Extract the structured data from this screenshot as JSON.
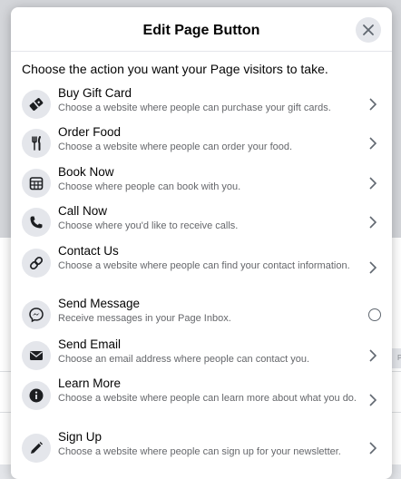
{
  "dialog": {
    "title": "Edit Page Button",
    "prompt": "Choose the action you want your Page visitors to take."
  },
  "background": {
    "pill_text": "Pr"
  },
  "options": [
    {
      "title": "Buy Gift Card",
      "description": "Choose a website where people can purchase your gift cards.",
      "icon": "gift-card-icon",
      "control": "chevron"
    },
    {
      "title": "Order Food",
      "description": "Choose a website where people can order your food.",
      "icon": "fork-knife-icon",
      "control": "chevron"
    },
    {
      "title": "Book Now",
      "description": "Choose where people can book with you.",
      "icon": "calendar-icon",
      "control": "chevron"
    },
    {
      "title": "Call Now",
      "description": "Choose where you'd like to receive calls.",
      "icon": "phone-icon",
      "control": "chevron"
    },
    {
      "title": "Contact Us",
      "description": "Choose a website where people can find your contact information.",
      "icon": "link-icon",
      "control": "chevron"
    },
    {
      "title": "Send Message",
      "description": "Receive messages in your Page Inbox.",
      "icon": "messenger-icon",
      "control": "radio"
    },
    {
      "title": "Send Email",
      "description": "Choose an email address where people can contact you.",
      "icon": "envelope-icon",
      "control": "chevron"
    },
    {
      "title": "Learn More",
      "description": "Choose a website where people can learn more about what you do.",
      "icon": "info-icon",
      "control": "chevron"
    },
    {
      "title": "Sign Up",
      "description": "Choose a website where people can sign up for your newsletter.",
      "icon": "pencil-icon",
      "control": "chevron"
    }
  ]
}
